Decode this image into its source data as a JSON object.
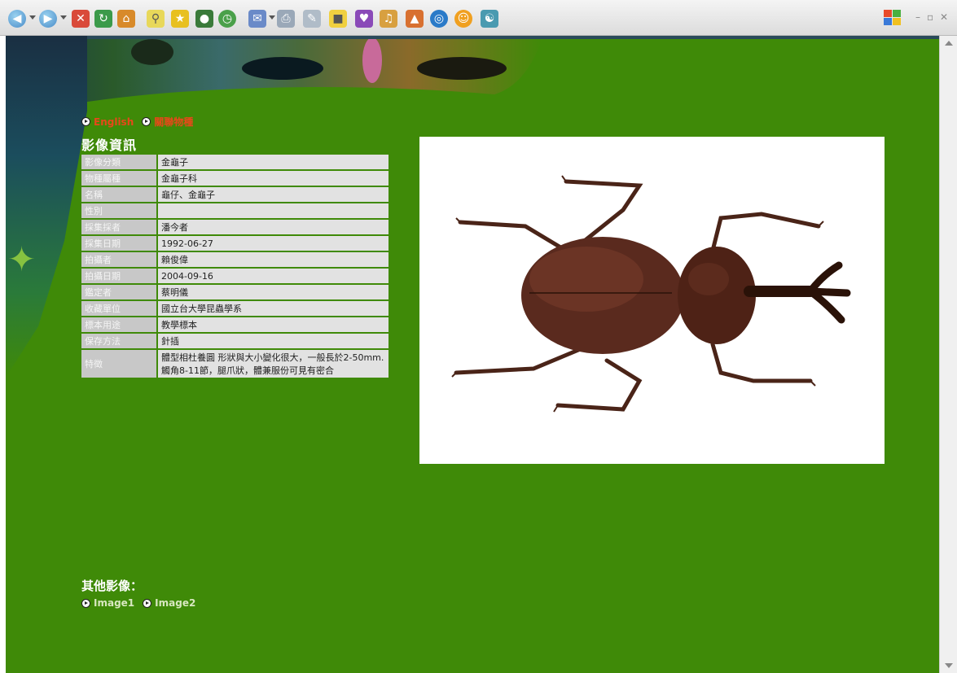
{
  "nav": {
    "english_label": "English",
    "rel_label": "關聯物種"
  },
  "section_title": "影像資訊",
  "info_rows": [
    {
      "label": "影像分類",
      "value": "金龜子"
    },
    {
      "label": "物種屬種",
      "value": "金龜子科"
    },
    {
      "label": "名稱",
      "value": "龜仔、金龜子"
    },
    {
      "label": "性別",
      "value": ""
    },
    {
      "label": "採集採者",
      "value": "潘今者"
    },
    {
      "label": "採集日期",
      "value": "1992-06-27"
    },
    {
      "label": "拍攝者",
      "value": "賴俊偉"
    },
    {
      "label": "拍攝日期",
      "value": "2004-09-16"
    },
    {
      "label": "鑑定者",
      "value": "蔡明儀"
    },
    {
      "label": "收藏單位",
      "value": "國立台大學昆蟲學系"
    },
    {
      "label": "標本用途",
      "value": "教學標本"
    },
    {
      "label": "保存方法",
      "value": "針插"
    },
    {
      "label": "特徵",
      "value": "體型相杜養圓 形狀與大小變化很大，一般長於2-50mm.觸角8-11節，腿爪狀，體兼服份可見有密合"
    }
  ],
  "other_images": {
    "title": "其他影像：",
    "links": [
      "Image1",
      "Image2"
    ]
  },
  "colors": {
    "page_bg": "#3f8a08",
    "link_red": "#e8481a",
    "label_bg": "#c8c8c8",
    "value_bg": "#e2e2e2"
  },
  "toolbar_icons": [
    "back-icon",
    "forward-icon",
    "stop-icon",
    "refresh-icon",
    "home-icon",
    "search-icon",
    "favorites-icon",
    "media-icon",
    "history-icon",
    "mail-icon",
    "print-icon",
    "edit-icon",
    "discuss-icon",
    "messenger-icon",
    "research-icon",
    "tools-icon",
    "globe-icon",
    "smiley-icon",
    "people-icon"
  ]
}
